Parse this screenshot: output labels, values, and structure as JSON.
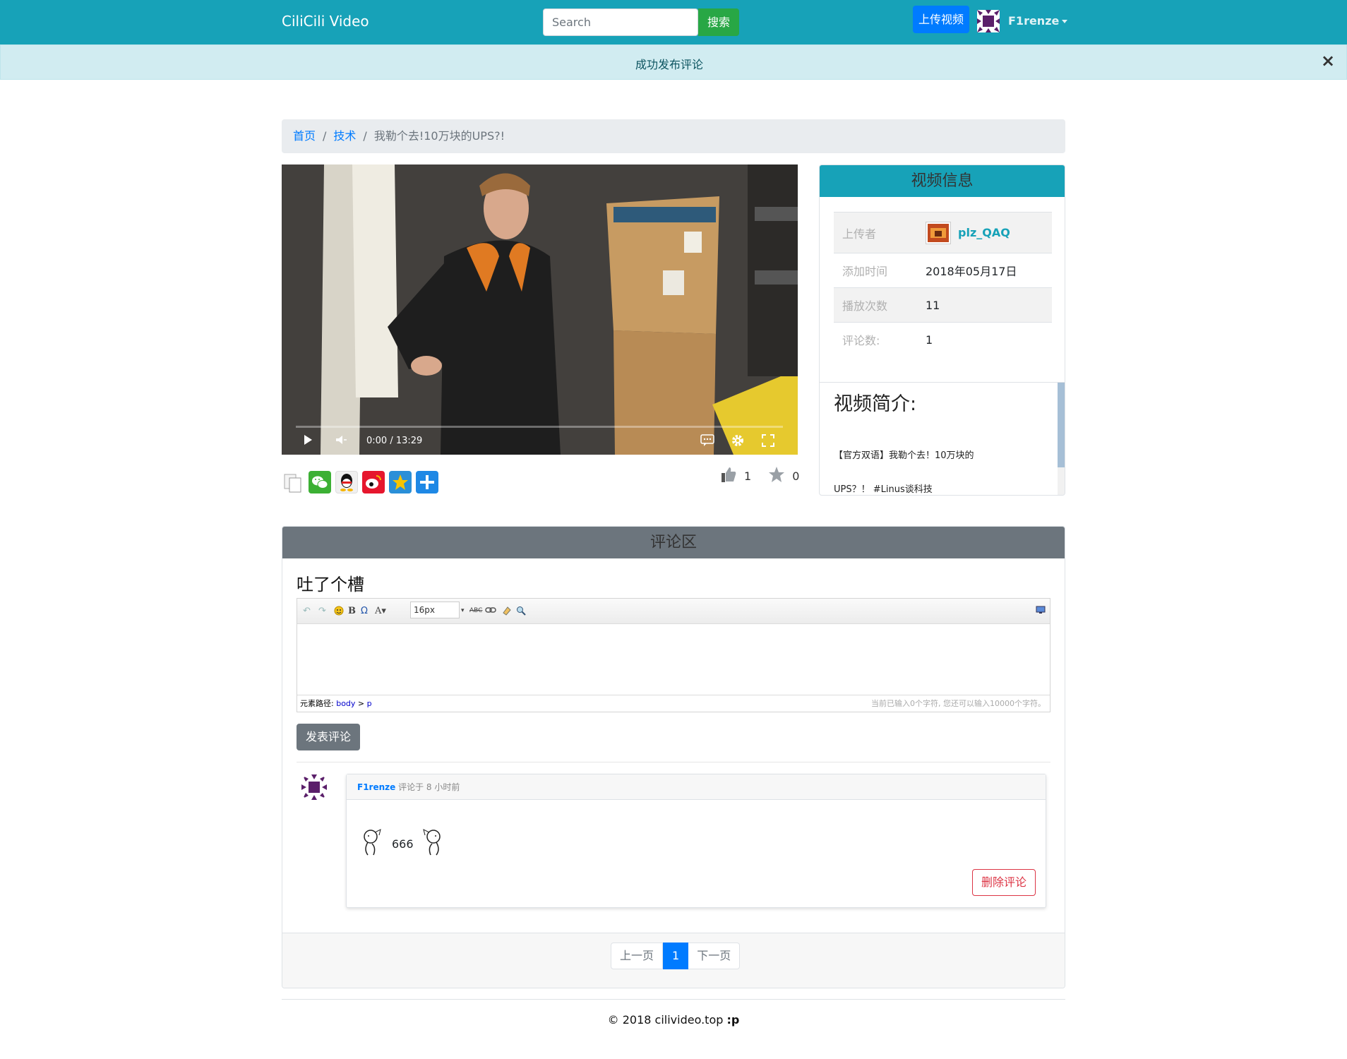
{
  "navbar": {
    "brand": "CiliCili Video",
    "search_placeholder": "Search",
    "search_button": "搜索",
    "upload_button": "上传视频",
    "username": "F1renze"
  },
  "alert": {
    "message": "成功发布评论",
    "close": "×"
  },
  "breadcrumb": {
    "home": "首页",
    "category": "技术",
    "current": "我勒个去!10万块的UPS?!"
  },
  "video": {
    "time": "0:00 / 13:29",
    "progress": 0
  },
  "stats": {
    "likes": "1",
    "favorites": "0"
  },
  "info": {
    "title": "视频信息",
    "rows": [
      {
        "label": "上传者",
        "value": "plz_QAQ"
      },
      {
        "label": "添加时间",
        "value": "2018年05月17日"
      },
      {
        "label": "播放次数",
        "value": "11"
      },
      {
        "label": "评论数:",
        "value": "1"
      }
    ],
    "intro_title": "视频简介:",
    "intro_line1": "【官方双语】我勒个去！10万块的",
    "intro_line2": "UPS？！ #Linus谈科技"
  },
  "comments": {
    "title": "评论区",
    "heading": "吐了个槽",
    "font_size": "16px",
    "path_label": "元素路径:",
    "path_body": "body",
    "path_p": "p",
    "char_count": "当前已输入0个字符, 您还可以输入10000个字符。",
    "submit": "发表评论",
    "items": [
      {
        "author": "F1renze",
        "meta": "评论于 8 小时前",
        "text": "666",
        "delete": "删除评论"
      }
    ],
    "pager": {
      "prev": "上一页",
      "current": "1",
      "next": "下一页"
    }
  },
  "footer": {
    "copyright": "© 2018  cilivideo.top",
    "smile": ":p"
  }
}
